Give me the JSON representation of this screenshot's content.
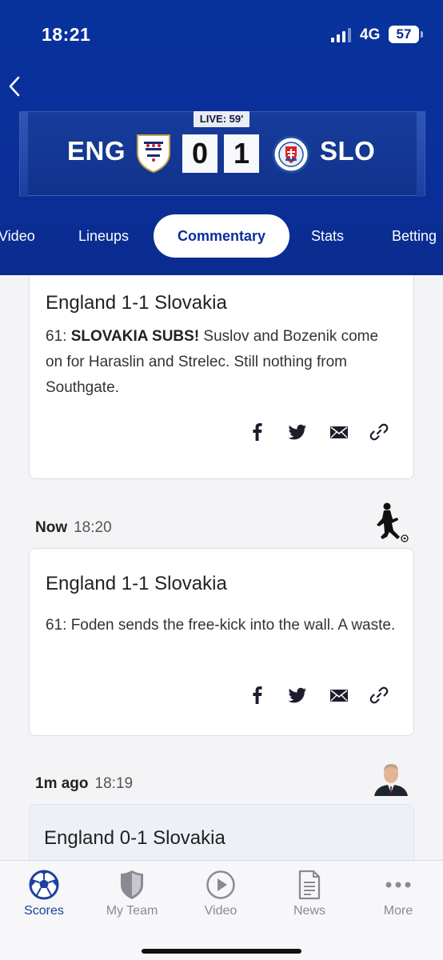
{
  "status_bar": {
    "time": "18:21",
    "network": "4G",
    "battery": "57"
  },
  "match": {
    "live_label": "LIVE: 59'",
    "home_team": "ENG",
    "away_team": "SLO",
    "home_score": "0",
    "away_score": "1"
  },
  "tabs": [
    {
      "label": "Video"
    },
    {
      "label": "Lineups"
    },
    {
      "label": "Commentary",
      "active": true
    },
    {
      "label": "Stats"
    },
    {
      "label": "Betting"
    }
  ],
  "feed": [
    {
      "title": "England 1-1 Slovakia",
      "body_bold": "61: SLOVAKIA SUBS!",
      "body_bold_prefix": "61: ",
      "body_bold_text": "SLOVAKIA SUBS!",
      "body_rest": " Suslov and Bozenik come on for Haraslin and Strelec. Still nothing from Southgate."
    },
    {
      "time_relative": "Now",
      "time_clock": "18:20",
      "avatar_icon": "footballer-icon",
      "title": "England 1-1 Slovakia",
      "body": "61: Foden sends the free-kick into the wall. A waste."
    },
    {
      "time_relative": "1m ago",
      "time_clock": "18:19",
      "avatar_icon": "commentator-avatar",
      "title": "England 0-1 Slovakia"
    }
  ],
  "share_icons": [
    "facebook-icon",
    "twitter-icon",
    "email-icon",
    "link-icon"
  ],
  "bottom_nav": [
    {
      "label": "Scores",
      "icon": "football-icon",
      "active": true
    },
    {
      "label": "My Team",
      "icon": "shield-icon"
    },
    {
      "label": "Video",
      "icon": "play-icon"
    },
    {
      "label": "News",
      "icon": "document-icon"
    },
    {
      "label": "More",
      "icon": "more-icon"
    }
  ],
  "colors": {
    "brand": "#0a2f9a",
    "active_nav": "#1d3fa0",
    "inactive_nav": "#8a8a95"
  }
}
